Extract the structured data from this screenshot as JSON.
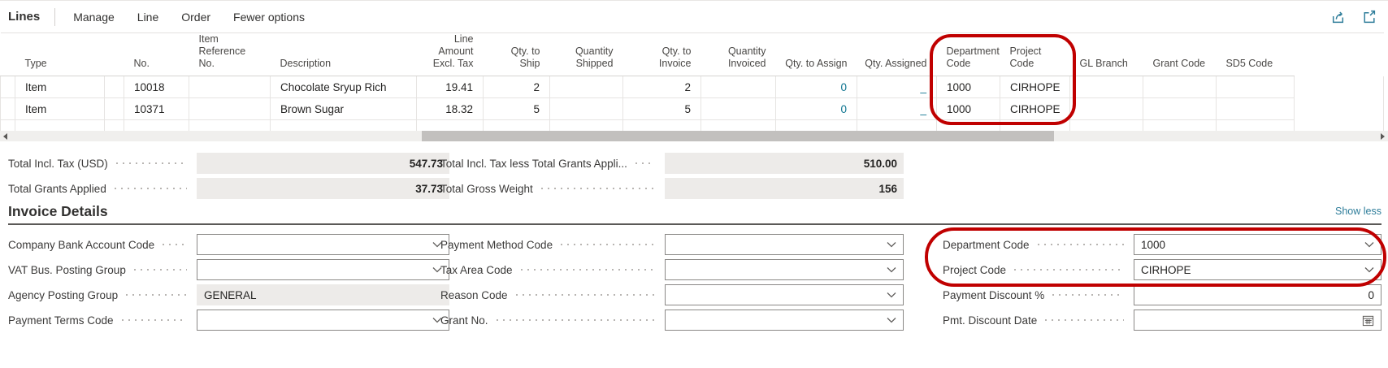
{
  "action_bar": {
    "title": "Lines",
    "menu_items": [
      "Manage",
      "Line",
      "Order",
      "Fewer options"
    ],
    "icons": [
      "share-icon",
      "popout-icon"
    ]
  },
  "table": {
    "headers": [
      "",
      "Type",
      "",
      "No.",
      "Item Reference No.",
      "Description",
      "Line Amount Excl. Tax",
      "Qty. to Ship",
      "Quantity Shipped",
      "Qty. to Invoice",
      "Quantity Invoiced",
      "Qty. to Assign",
      "Qty. Assigned",
      "Department Code",
      "Project Code",
      "GL Branch",
      "Grant Code",
      "SD5 Code"
    ],
    "rows": [
      [
        "",
        "Item",
        "",
        "10018",
        "",
        "Chocolate Sryup Rich",
        "19.41",
        "2",
        "",
        "2",
        "",
        "0",
        "_",
        "1000",
        "CIRHOPE",
        "",
        "",
        ""
      ],
      [
        "",
        "Item",
        "",
        "10371",
        "",
        "Brown Sugar",
        "18.32",
        "5",
        "",
        "5",
        "",
        "0",
        "_",
        "1000",
        "CIRHOPE",
        "",
        "",
        ""
      ],
      [
        "",
        "",
        "",
        "",
        "",
        "",
        "",
        "",
        "",
        "",
        "",
        "",
        "",
        "",
        "",
        "",
        "",
        ""
      ]
    ]
  },
  "totals": {
    "total_incl_tax": {
      "label": "Total Incl. Tax (USD)",
      "value": "547.73"
    },
    "total_grants_applied": {
      "label": "Total Grants Applied",
      "value": "37.73"
    },
    "total_incl_tax_less_grants": {
      "label": "Total Incl. Tax less Total Grants Appli...",
      "value": "510.00"
    },
    "total_gross_weight": {
      "label": "Total Gross Weight",
      "value": "156"
    }
  },
  "invoice_details": {
    "heading": "Invoice Details",
    "show_less_label": "Show less",
    "column1": [
      {
        "label": "Company Bank Account Code",
        "value": "",
        "control": "dropdown"
      },
      {
        "label": "VAT Bus. Posting Group",
        "value": "",
        "control": "dropdown"
      },
      {
        "label": "Agency Posting Group",
        "value": "GENERAL",
        "control": "readonly"
      },
      {
        "label": "Payment Terms Code",
        "value": "",
        "control": "dropdown"
      }
    ],
    "column2": [
      {
        "label": "Payment Method Code",
        "value": "",
        "control": "dropdown"
      },
      {
        "label": "Tax Area Code",
        "value": "",
        "control": "dropdown"
      },
      {
        "label": "Reason Code",
        "value": "",
        "control": "dropdown"
      },
      {
        "label": "Grant No.",
        "value": "",
        "control": "dropdown"
      }
    ],
    "column3": [
      {
        "label": "Department Code",
        "value": "1000",
        "control": "dropdown"
      },
      {
        "label": "Project Code",
        "value": "CIRHOPE",
        "control": "dropdown"
      },
      {
        "label": "Payment Discount %",
        "value": "0",
        "control": "number"
      },
      {
        "label": "Pmt. Discount Date",
        "value": "",
        "control": "date"
      }
    ]
  },
  "colors": {
    "highlight_red": "#c00000",
    "link_teal": "#0e7490",
    "icon_teal": "#2e7d9a",
    "readonly_gray": "#edebe9"
  }
}
